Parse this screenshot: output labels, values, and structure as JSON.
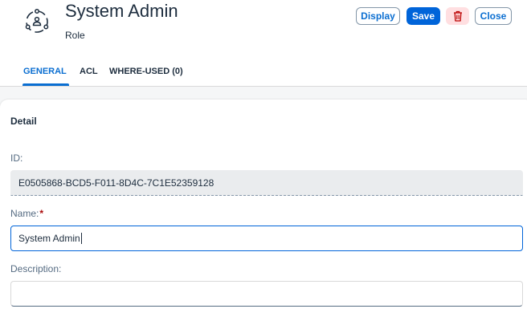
{
  "header": {
    "title": "System Admin",
    "subtitle": "Role",
    "icon": "role-icon",
    "buttons": {
      "display": "Display",
      "save": "Save",
      "delete_icon": "trash-icon",
      "close": "Close"
    }
  },
  "tabs": [
    {
      "label": "GENERAL",
      "active": true
    },
    {
      "label": "ACL",
      "active": false
    },
    {
      "label": "WHERE-USED (0)",
      "active": false
    }
  ],
  "detail": {
    "section_title": "Detail",
    "id": {
      "label": "ID:",
      "value": "E0505868-BCD5-F011-8D4C-7C1E52359128"
    },
    "name": {
      "label": "Name:",
      "required_mark": "*",
      "value": "System Admin"
    },
    "description": {
      "label": "Description:",
      "value": ""
    }
  },
  "colors": {
    "accent": "#0a6ed1",
    "save_bg": "#0064d9",
    "delete_bg": "#ffdfe1",
    "delete_icon": "#bb0000",
    "required": "#aa0808"
  }
}
